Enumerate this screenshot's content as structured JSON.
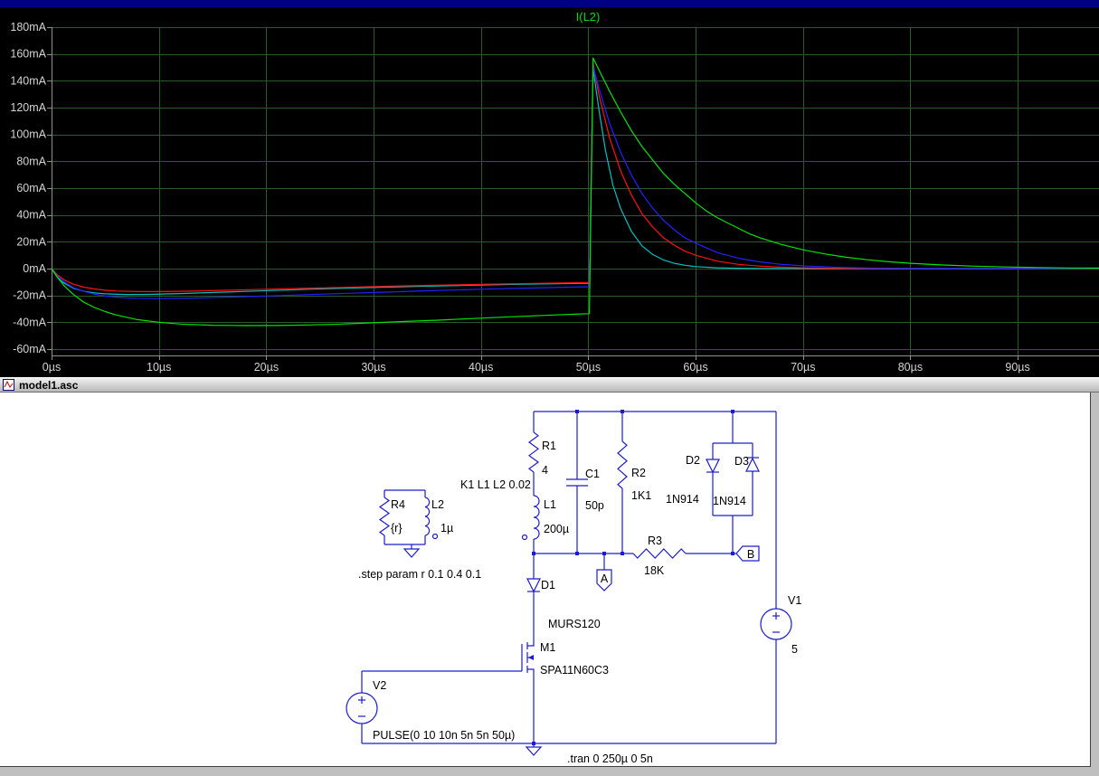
{
  "plot": {
    "title": "I(L2)",
    "y_tick_labels": [
      "180mA",
      "160mA",
      "140mA",
      "120mA",
      "100mA",
      "80mA",
      "60mA",
      "40mA",
      "20mA",
      "0mA",
      "-20mA",
      "-40mA",
      "-60mA"
    ],
    "x_tick_labels": [
      "0µs",
      "10µs",
      "20µs",
      "30µs",
      "40µs",
      "50µs",
      "60µs",
      "70µs",
      "80µs",
      "90µs"
    ]
  },
  "chart_data": {
    "type": "line",
    "title": "I(L2)",
    "x_unit": "µs",
    "y_unit": "mA",
    "x_range": [
      0,
      97.6
    ],
    "y_range": [
      -60,
      180
    ],
    "x_ticks": [
      0,
      10,
      20,
      30,
      40,
      50,
      60,
      70,
      80,
      90
    ],
    "y_ticks": [
      180,
      160,
      140,
      120,
      100,
      80,
      60,
      40,
      20,
      0,
      -20,
      -40,
      -60
    ],
    "grid": true,
    "background": "#000000",
    "legend_position": "none",
    "series": [
      {
        "name": "green",
        "color": "#00e400",
        "points": [
          [
            0,
            0
          ],
          [
            0.6,
            -7
          ],
          [
            1.2,
            -13
          ],
          [
            2,
            -19
          ],
          [
            3,
            -25
          ],
          [
            4,
            -29
          ],
          [
            5,
            -32
          ],
          [
            6,
            -34.5
          ],
          [
            8,
            -38
          ],
          [
            10,
            -40
          ],
          [
            12,
            -41.3
          ],
          [
            15,
            -42.2
          ],
          [
            18,
            -42.5
          ],
          [
            21,
            -42.4
          ],
          [
            24,
            -42
          ],
          [
            27,
            -41.3
          ],
          [
            30,
            -40.4
          ],
          [
            33,
            -39.4
          ],
          [
            36,
            -38.4
          ],
          [
            39,
            -37.3
          ],
          [
            42,
            -36.2
          ],
          [
            45,
            -35.2
          ],
          [
            48,
            -34.2
          ],
          [
            50.1,
            -33.6
          ],
          [
            50.45,
            157
          ],
          [
            51,
            148
          ],
          [
            52,
            132
          ],
          [
            53,
            117
          ],
          [
            54,
            103
          ],
          [
            55,
            91
          ],
          [
            56,
            81
          ],
          [
            57,
            71
          ],
          [
            58,
            63
          ],
          [
            59,
            56
          ],
          [
            60,
            49
          ],
          [
            61,
            43
          ],
          [
            62,
            38
          ],
          [
            63,
            34
          ],
          [
            64,
            30
          ],
          [
            65,
            26
          ],
          [
            66,
            23
          ],
          [
            68,
            18
          ],
          [
            70,
            14
          ],
          [
            72,
            11
          ],
          [
            74,
            8.5
          ],
          [
            76,
            6.6
          ],
          [
            78,
            5.1
          ],
          [
            80,
            4
          ],
          [
            83,
            2.7
          ],
          [
            86,
            1.8
          ],
          [
            89,
            1.2
          ],
          [
            92,
            0.8
          ],
          [
            95,
            0.5
          ],
          [
            97.6,
            0.4
          ]
        ]
      },
      {
        "name": "blue",
        "color": "#2222ff",
        "points": [
          [
            0,
            0
          ],
          [
            0.6,
            -6
          ],
          [
            1.2,
            -10
          ],
          [
            2,
            -14
          ],
          [
            3,
            -17
          ],
          [
            4,
            -19
          ],
          [
            5,
            -20.5
          ],
          [
            6,
            -21.3
          ],
          [
            8,
            -22.1
          ],
          [
            10,
            -22.3
          ],
          [
            13,
            -22
          ],
          [
            16,
            -21.4
          ],
          [
            20,
            -20.4
          ],
          [
            25,
            -19.1
          ],
          [
            30,
            -17.8
          ],
          [
            35,
            -16.5
          ],
          [
            40,
            -15.4
          ],
          [
            45,
            -14.4
          ],
          [
            50.1,
            -13.5
          ],
          [
            50.45,
            151
          ],
          [
            51,
            134
          ],
          [
            52,
            108
          ],
          [
            53,
            87
          ],
          [
            54,
            70
          ],
          [
            55,
            56
          ],
          [
            56,
            45
          ],
          [
            57,
            36
          ],
          [
            58,
            29
          ],
          [
            59,
            23
          ],
          [
            60,
            19
          ],
          [
            62,
            12
          ],
          [
            64,
            7.7
          ],
          [
            66,
            5
          ],
          [
            68,
            3.2
          ],
          [
            70,
            2.1
          ],
          [
            73,
            1
          ],
          [
            76,
            0.5
          ],
          [
            80,
            0.2
          ],
          [
            97.6,
            0
          ]
        ]
      },
      {
        "name": "red",
        "color": "#ff1010",
        "points": [
          [
            0,
            0
          ],
          [
            0.6,
            -5
          ],
          [
            1.2,
            -8.5
          ],
          [
            2,
            -11.5
          ],
          [
            3,
            -13.8
          ],
          [
            4,
            -15.2
          ],
          [
            5,
            -16.1
          ],
          [
            6,
            -16.7
          ],
          [
            8,
            -17.1
          ],
          [
            10,
            -17.1
          ],
          [
            13,
            -16.8
          ],
          [
            16,
            -16.2
          ],
          [
            20,
            -15.4
          ],
          [
            25,
            -14.4
          ],
          [
            30,
            -13.4
          ],
          [
            35,
            -12.5
          ],
          [
            40,
            -11.7
          ],
          [
            45,
            -11
          ],
          [
            50.1,
            -10.4
          ],
          [
            50.45,
            153
          ],
          [
            51,
            129
          ],
          [
            52,
            97
          ],
          [
            53,
            73
          ],
          [
            54,
            55
          ],
          [
            55,
            41
          ],
          [
            56,
            31
          ],
          [
            57,
            23
          ],
          [
            58,
            17.5
          ],
          [
            59,
            13
          ],
          [
            60,
            10
          ],
          [
            62,
            5.6
          ],
          [
            64,
            3.2
          ],
          [
            66,
            1.8
          ],
          [
            68,
            1
          ],
          [
            70,
            0.6
          ],
          [
            73,
            0.25
          ],
          [
            76,
            0.1
          ],
          [
            97.6,
            0
          ]
        ]
      },
      {
        "name": "cyan",
        "color": "#00c0c0",
        "points": [
          [
            0,
            0
          ],
          [
            0.5,
            -6
          ],
          [
            1,
            -10
          ],
          [
            2,
            -14.5
          ],
          [
            3,
            -16.9
          ],
          [
            4,
            -18.1
          ],
          [
            5,
            -18.8
          ],
          [
            7,
            -19.3
          ],
          [
            9,
            -19.2
          ],
          [
            12,
            -18.6
          ],
          [
            15,
            -17.8
          ],
          [
            19,
            -16.7
          ],
          [
            24,
            -15.4
          ],
          [
            29,
            -14.2
          ],
          [
            34,
            -13.2
          ],
          [
            39,
            -12.4
          ],
          [
            44,
            -11.6
          ],
          [
            50.1,
            -10.9
          ],
          [
            50.45,
            149
          ],
          [
            51,
            118
          ],
          [
            51.6,
            88
          ],
          [
            52.3,
            62
          ],
          [
            53,
            45
          ],
          [
            54,
            28
          ],
          [
            55,
            17
          ],
          [
            56,
            10.5
          ],
          [
            57,
            6.5
          ],
          [
            58,
            4
          ],
          [
            59,
            2.5
          ],
          [
            60,
            1.5
          ],
          [
            62,
            0.6
          ],
          [
            64,
            0.25
          ],
          [
            66,
            0.1
          ],
          [
            70,
            0
          ],
          [
            97.6,
            0
          ]
        ]
      }
    ]
  },
  "schematic_window": {
    "title": "model1.asc"
  },
  "schematic": {
    "components": [
      {
        "id": "R1",
        "name": "R1",
        "value": "4"
      },
      {
        "id": "C1",
        "name": "C1",
        "value": "50p"
      },
      {
        "id": "R2",
        "name": "R2",
        "value": "1K1"
      },
      {
        "id": "D2",
        "name": "D2",
        "value": "1N914"
      },
      {
        "id": "D3",
        "name": "D3",
        "value": "1N914"
      },
      {
        "id": "R4",
        "name": "R4",
        "value": "{r}"
      },
      {
        "id": "L2",
        "name": "L2",
        "value": "1µ"
      },
      {
        "id": "L1",
        "name": "L1",
        "value": "200µ"
      },
      {
        "id": "R3",
        "name": "R3",
        "value": "18K"
      },
      {
        "id": "D1",
        "name": "D1",
        "value": "MURS120"
      },
      {
        "id": "M1",
        "name": "M1",
        "value": "SPA11N60C3"
      },
      {
        "id": "V1",
        "name": "V1",
        "value": "5"
      },
      {
        "id": "V2",
        "name": "V2",
        "value": "PULSE(0 10 10n 5n 5n 50µ)"
      }
    ],
    "directives": [
      {
        "id": "k1",
        "text": "K1 L1 L2 0.02"
      },
      {
        "id": "step",
        "text": ".step param r 0.1 0.4 0.1"
      },
      {
        "id": "tran",
        "text": ".tran 0 250µ 0 5n"
      }
    ],
    "net_labels": [
      {
        "id": "A",
        "text": "A"
      },
      {
        "id": "B",
        "text": "B"
      }
    ]
  }
}
